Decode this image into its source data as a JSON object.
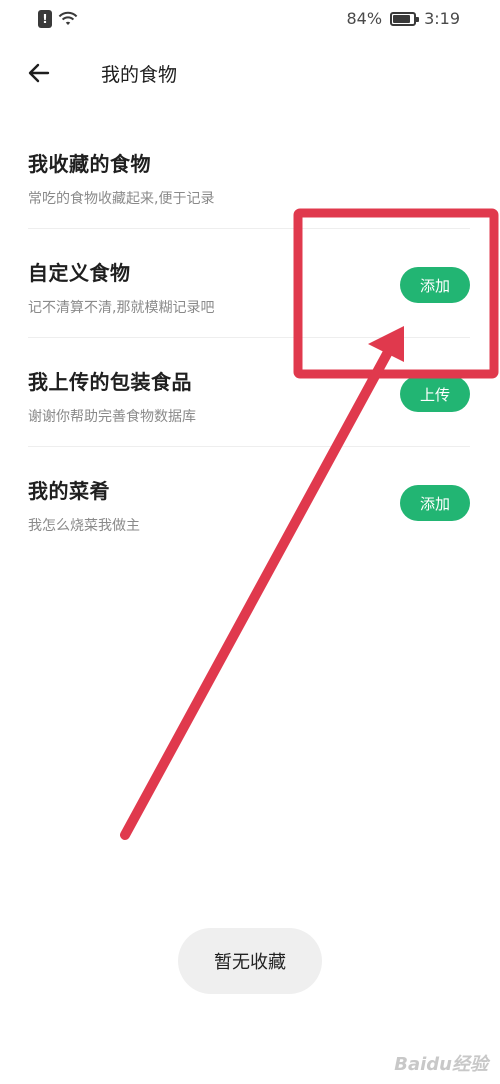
{
  "status_bar": {
    "battery": "84%",
    "time": "3:19",
    "icons": [
      "alert-icon",
      "wifi-icon",
      "battery-icon"
    ]
  },
  "header": {
    "back_icon": "back-arrow-icon",
    "title": "我的食物"
  },
  "items": [
    {
      "title": "我收藏的食物",
      "subtitle": "常吃的食物收藏起来,便于记录",
      "button": null
    },
    {
      "title": "自定义食物",
      "subtitle": "记不清算不清,那就模糊记录吧",
      "button": "添加"
    },
    {
      "title": "我上传的包装食品",
      "subtitle": "谢谢你帮助完善食物数据库",
      "button": "上传"
    },
    {
      "title": "我的菜肴",
      "subtitle": "我怎么烧菜我做主",
      "button": "添加"
    }
  ],
  "toast": "暂无收藏",
  "colors": {
    "accent_green": "#22b573",
    "annotation_red": "#e0394d",
    "subtitle_gray": "#8a8a8a"
  },
  "watermark": "Baidu经验"
}
